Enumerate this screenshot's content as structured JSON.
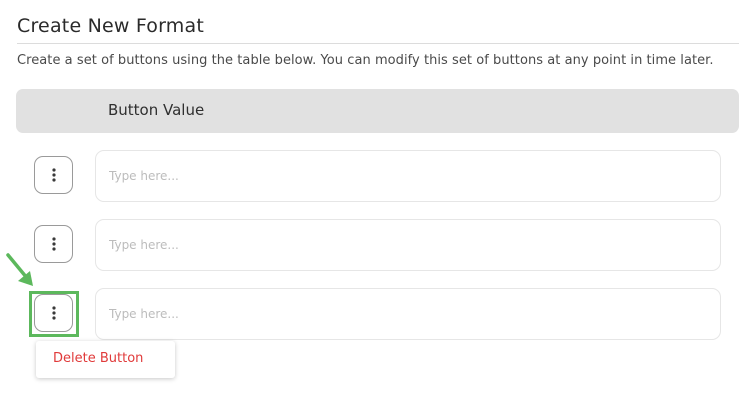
{
  "header": {
    "title": "Create New Format",
    "description": "Create a set of buttons using the table below. You can modify this set of buttons at any point in time later."
  },
  "table": {
    "column_header": "Button Value",
    "rows": [
      {
        "value": "",
        "placeholder": "Type here..."
      },
      {
        "value": "",
        "placeholder": "Type here..."
      },
      {
        "value": "",
        "placeholder": "Type here..."
      }
    ]
  },
  "context_menu": {
    "items": [
      {
        "label": "Delete Button"
      }
    ]
  },
  "annotation": {
    "highlight_color": "#5cb85c",
    "arrow_icon": "arrow-down-right-icon"
  },
  "colors": {
    "danger": "#e03a3a",
    "header_bg": "#e1e1e1",
    "accent_green": "#5cb85c"
  }
}
